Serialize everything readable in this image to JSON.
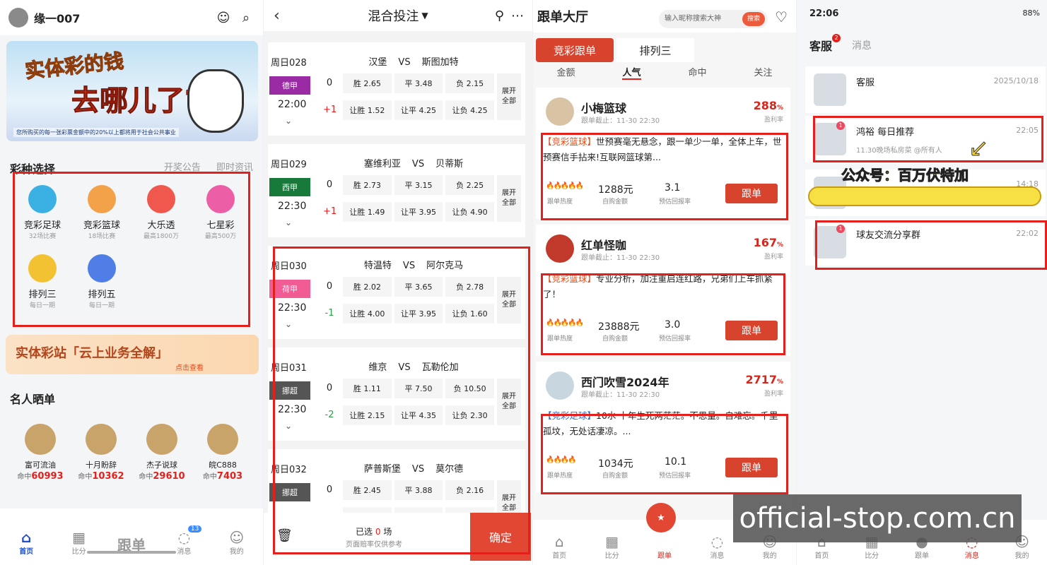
{
  "p1": {
    "username": "缘一007",
    "banner": {
      "line1": "实体彩的钱",
      "line2": "去哪儿了?",
      "footnote": "您所购买的每一张彩票金额中的20%以上都将用于社会公共事业"
    },
    "section_title": "彩种选择",
    "links": [
      "开奖公告",
      "即时资讯"
    ],
    "lotteries": [
      {
        "name": "竞彩足球",
        "sub": "32场比赛",
        "color": "#3bb0e3"
      },
      {
        "name": "竞彩篮球",
        "sub": "18场比赛",
        "color": "#f4a24a"
      },
      {
        "name": "大乐透",
        "sub": "最高1800万",
        "color": "#f0574d"
      },
      {
        "name": "七星彩",
        "sub": "最高500万",
        "color": "#ec5ea6"
      },
      {
        "name": "排列三",
        "sub": "每日一期",
        "color": "#f2c233"
      },
      {
        "name": "排列五",
        "sub": "每日一期",
        "color": "#4f7ee6"
      }
    ],
    "promo": {
      "title": "实体彩站「云上业务全解」",
      "sub": "点击查看"
    },
    "stars_title": "名人晒单",
    "stars": [
      {
        "name": "富可流油",
        "hit": "60993"
      },
      {
        "name": "十月盼辞",
        "hit": "10362"
      },
      {
        "name": "杰子说球",
        "hit": "29610"
      },
      {
        "name": "皖C888",
        "hit": "7403"
      }
    ],
    "hit_label": "命中",
    "tabs": [
      {
        "label": "首页",
        "icon": "⌂"
      },
      {
        "label": "比分",
        "icon": "▦"
      },
      {
        "label": "跟单",
        "icon": ""
      },
      {
        "label": "消息",
        "icon": "◌",
        "badge": "13"
      },
      {
        "label": "我的",
        "icon": "☺"
      }
    ]
  },
  "p2": {
    "title": "混合投注",
    "matches": [
      {
        "day": "周日028",
        "league": "德甲",
        "league_color": "#9b2aa5",
        "time": "22:00",
        "home": "汉堡",
        "away": "斯图加特",
        "hcp": "+1",
        "r1": [
          "胜 2.65",
          "平 3.48",
          "负 2.15"
        ],
        "r2": [
          "让胜 1.52",
          "让平 4.25",
          "让负 4.25"
        ]
      },
      {
        "day": "周日029",
        "league": "西甲",
        "league_color": "#177a3a",
        "time": "22:30",
        "home": "塞维利亚",
        "away": "贝蒂斯",
        "hcp": "+1",
        "r1": [
          "胜 2.73",
          "平 3.15",
          "负 2.25"
        ],
        "r2": [
          "让胜 1.49",
          "让平 3.95",
          "让负 4.90"
        ]
      },
      {
        "day": "周日030",
        "league": "荷甲",
        "league_color": "#f25c94",
        "time": "22:30",
        "home": "特温特",
        "away": "阿尔克马",
        "hcp": "-1",
        "r1": [
          "胜 2.02",
          "平 3.65",
          "负 2.78"
        ],
        "r2": [
          "让胜 4.00",
          "让平 3.95",
          "让负 1.60"
        ]
      },
      {
        "day": "周日031",
        "league": "挪超",
        "league_color": "#555555",
        "time": "22:30",
        "home": "维京",
        "away": "瓦勒伦加",
        "hcp": "-2",
        "r1": [
          "胜 1.11",
          "平 7.50",
          "负 10.50"
        ],
        "r2": [
          "让胜 2.15",
          "让平 4.35",
          "让负 2.30"
        ]
      },
      {
        "day": "周日032",
        "league": "挪超",
        "league_color": "#555555",
        "time": "",
        "home": "萨普斯堡",
        "away": "莫尔德",
        "hcp": "",
        "r1": [
          "胜 2.45",
          "平 3.88",
          "负 2.16"
        ],
        "r2": [
          "",
          "",
          ""
        ]
      }
    ],
    "zero": "0",
    "vs": "VS",
    "expand": "展开\n全部",
    "selected_prefix": "已选",
    "selected_count": "0",
    "selected_suffix": "场",
    "note": "页面赔率仅供参考",
    "confirm": "确定"
  },
  "p3": {
    "title": "跟单大厅",
    "search_placeholder": "输入昵称搜索大神",
    "search_btn": "搜索",
    "tab_sel": "竞彩跟单",
    "tab_un": "排列三",
    "subtabs": [
      "金额",
      "人气",
      "命中",
      "关注"
    ],
    "cards": [
      {
        "name": "小梅篮球",
        "deadline": "跟单截止：11-30 22:30",
        "pct": "288",
        "tag": "【竞彩篮球】",
        "text": "世预赛毫无悬念，跟一单少一单，全体上车，世预赛信手拈来!互联网篮球第...",
        "flames": "🔥🔥🔥🔥🔥",
        "amount": "1288元",
        "ret": "3.1"
      },
      {
        "name": "红单怪咖",
        "deadline": "跟单截止：11-30 22:30",
        "pct": "167",
        "tag": "【竞彩篮球】",
        "text": "专业分析，加注重启连红路，兄弟们上车抓紧了！",
        "flames": "🔥🔥🔥🔥🔥",
        "amount": "23888元",
        "ret": "3.0"
      },
      {
        "name": "西门吹雪2024年",
        "deadline": "跟单截止：11-30 22:30",
        "pct": "2717",
        "tag": "【竞彩足球】",
        "text": "10水 十年生死两茫茫。不思量。自难忘。千里孤坟，无处话凄凉。...",
        "flames": "🔥🔥🔥🔥",
        "amount": "1034元",
        "ret": "10.1"
      }
    ],
    "pct_unit": "%",
    "pct_label": "盈利率",
    "heat_label": "跟单热度",
    "amount_label": "自购金额",
    "ret_label": "预估回报率",
    "follow": "跟单",
    "tabs": [
      "首页",
      "比分",
      "跟单",
      "消息",
      "我的"
    ]
  },
  "p4": {
    "time": "22:06",
    "battery": "88%",
    "tab1": "客服",
    "tab1_badge": "2",
    "tab2": "消息",
    "chats": [
      {
        "name": "客服",
        "time": "2025/10/18",
        "sub": "",
        "dot": ""
      },
      {
        "name": "鸿裕 每日推荐",
        "time": "22:05",
        "sub": "11.30晚场私房菜 @所有人",
        "dot": "1"
      },
      {
        "name": "",
        "time": "14:18",
        "sub": "",
        "dot": ""
      },
      {
        "name": "球友交流分享群",
        "time": "22:02",
        "sub": "",
        "dot": "1"
      }
    ],
    "overlay_text": "公众号：百万伏特加",
    "tabs": [
      "首页",
      "比分",
      "跟单",
      "消息",
      "我的"
    ]
  },
  "watermark": "official-stop.com.cn"
}
